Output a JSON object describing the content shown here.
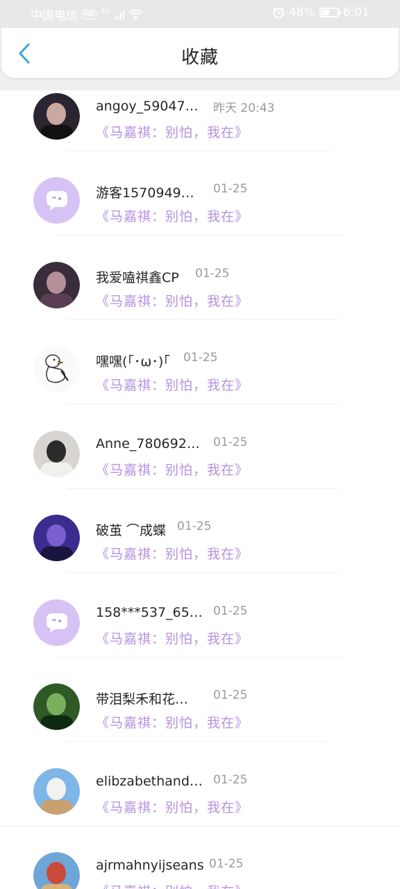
{
  "status": {
    "carrier": "中国电信",
    "hd": "HD",
    "network": "4G",
    "battery": "48%",
    "battery_level": 0.48,
    "time": "6:01"
  },
  "header": {
    "title": "收藏",
    "back_icon": "chevron-left-icon"
  },
  "colors": {
    "accent": "#b592e0",
    "back": "#3aa2e0",
    "time": "#9a9a9a"
  },
  "items": [
    {
      "name": "angoy_59047…",
      "time": "昨天 20:43",
      "book": "《马嘉祺：别怕，我在》",
      "avatar": "photo"
    },
    {
      "name": "游客1570949…",
      "time": "01-25",
      "book": "《马嘉祺：别怕，我在》",
      "avatar": "default-chat"
    },
    {
      "name": "我爱嗑祺鑫CP",
      "time": "01-25",
      "book": "《马嘉祺：别怕，我在》",
      "avatar": "photo"
    },
    {
      "name": "嘿嘿(｢･ω･)｢",
      "time": "01-25",
      "book": "《马嘉祺：别怕，我在》",
      "avatar": "duck"
    },
    {
      "name": "Anne_780692…",
      "time": "01-25",
      "book": "《马嘉祺：别怕，我在》",
      "avatar": "photo"
    },
    {
      "name": "破茧 ⌒成蝶",
      "time": "01-25",
      "book": "《马嘉祺：别怕，我在》",
      "avatar": "photo"
    },
    {
      "name": "158***537_65…",
      "time": "01-25",
      "book": "《马嘉祺：别怕，我在》",
      "avatar": "default-chat"
    },
    {
      "name": "带泪梨禾和花…",
      "time": "01-25",
      "book": "《马嘉祺：别怕，我在》",
      "avatar": "photo"
    },
    {
      "name": "elibzabethand…",
      "time": "01-25",
      "book": "《马嘉祺：别怕，我在》",
      "avatar": "photo"
    },
    {
      "name": "ajrmahnyijseans",
      "time": "01-25",
      "book": "《马嘉祺：别怕，我在》",
      "avatar": "photo"
    }
  ]
}
